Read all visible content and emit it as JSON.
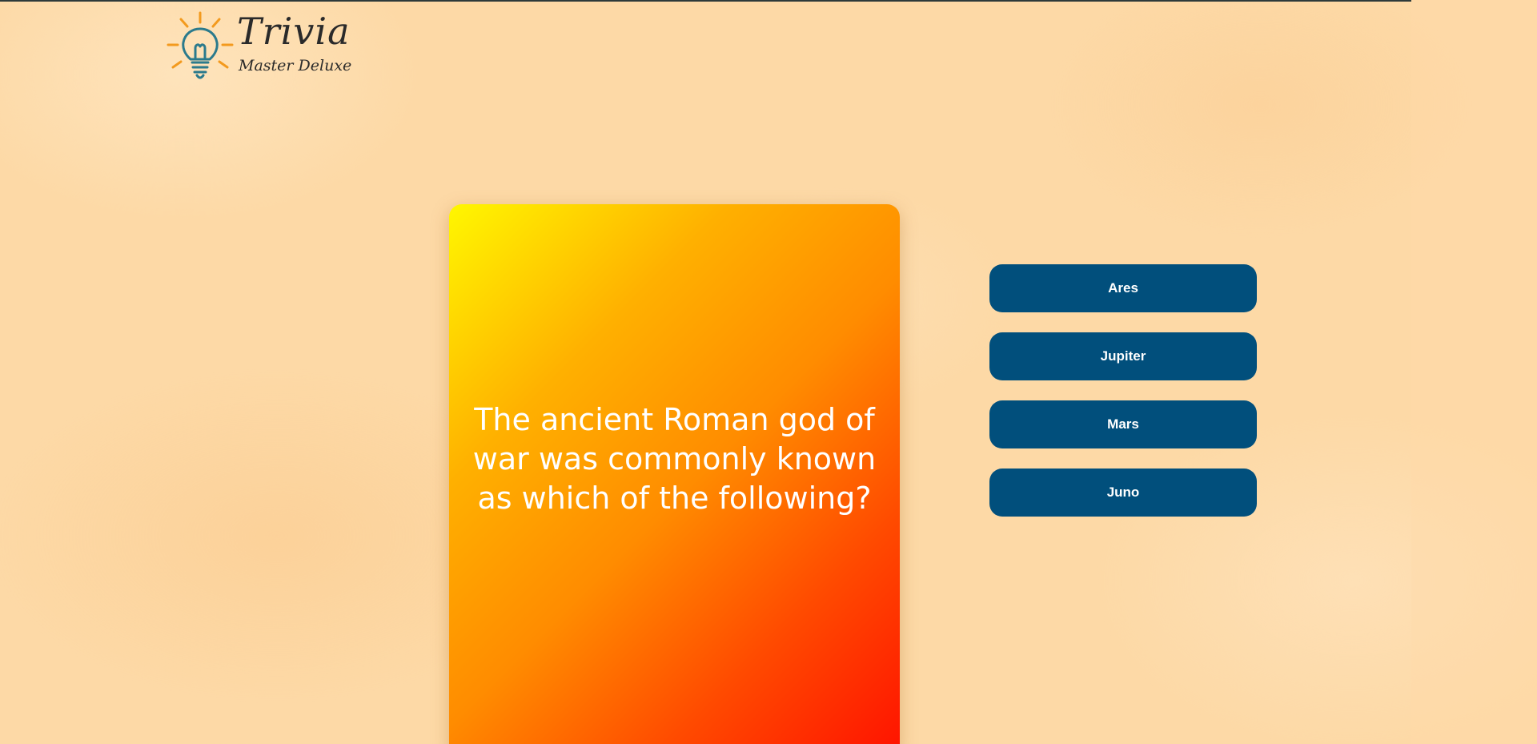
{
  "brand": {
    "title": "Trivia",
    "subtitle": "Master Deluxe",
    "icon": "lightbulb-icon"
  },
  "question": {
    "text": "The ancient Roman god of war was commonly known as which of the following?"
  },
  "answers": [
    {
      "label": "Ares"
    },
    {
      "label": "Jupiter"
    },
    {
      "label": "Mars"
    },
    {
      "label": "Juno"
    }
  ],
  "colors": {
    "background": "#fdd9a6",
    "answer_button": "#014f7c",
    "answer_text": "#ffffff",
    "card_gradient_start": "#fff700",
    "card_gradient_end": "#ff1200",
    "logo_bulb": "#2b7a8c",
    "logo_rays": "#f39a1e"
  }
}
